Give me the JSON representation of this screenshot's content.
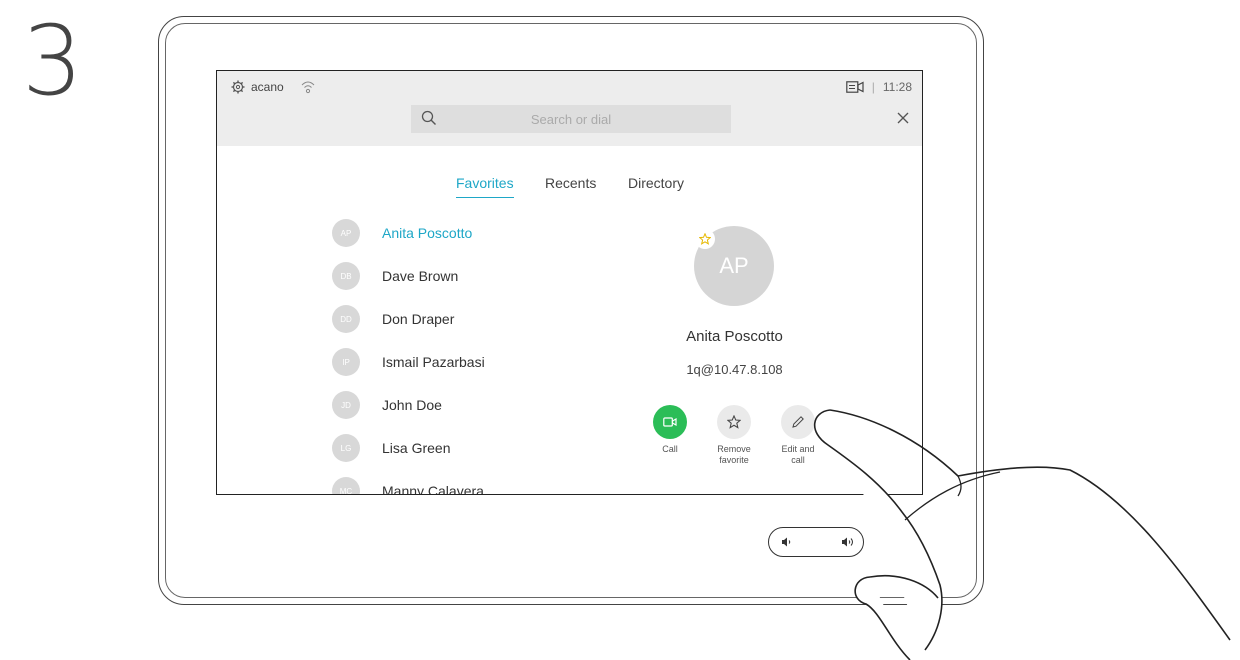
{
  "step_number": "3",
  "status": {
    "system_name": "acano",
    "time": "11:28"
  },
  "search": {
    "placeholder": "Search or dial"
  },
  "tabs": [
    {
      "label": "Favorites",
      "active": true
    },
    {
      "label": "Recents",
      "active": false
    },
    {
      "label": "Directory",
      "active": false
    }
  ],
  "contacts": [
    {
      "initials": "AP",
      "name": "Anita Poscotto",
      "selected": true
    },
    {
      "initials": "DB",
      "name": "Dave Brown"
    },
    {
      "initials": "DD",
      "name": "Don Draper"
    },
    {
      "initials": "IP",
      "name": "Ismail Pazarbasi"
    },
    {
      "initials": "JD",
      "name": "John Doe"
    },
    {
      "initials": "LG",
      "name": "Lisa Green"
    },
    {
      "initials": "MC",
      "name": "Manny Calavera"
    }
  ],
  "detail": {
    "initials": "AP",
    "name": "Anita Poscotto",
    "address": "1q@10.47.8.108",
    "actions": {
      "call": "Call",
      "remove_favorite_1": "Remove",
      "remove_favorite_2": "favorite",
      "edit_call_1": "Edit and",
      "edit_call_2": "call"
    }
  },
  "colors": {
    "accent": "#1ea7c7",
    "call_green": "#2bbd57",
    "topbar": "#ededed"
  }
}
